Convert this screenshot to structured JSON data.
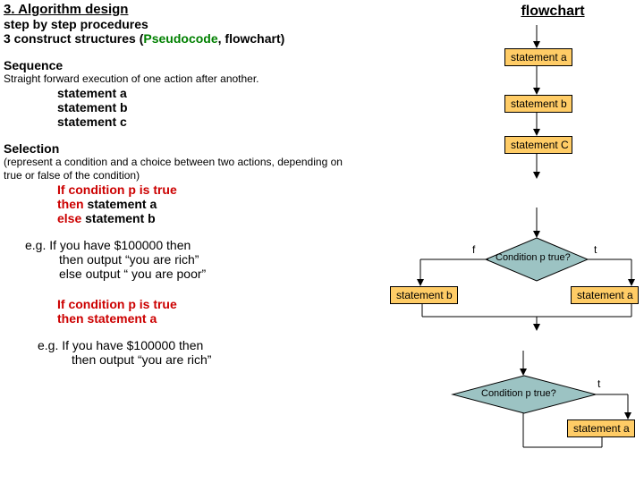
{
  "header": {
    "title": "3. Algorithm design",
    "sub1": "step by step procedures",
    "sub2a": "3 construct structures (",
    "sub2b": "Pseudocode",
    "sub2c": ", flowchart)"
  },
  "sequence": {
    "head": "Sequence",
    "desc": "Straight forward execution of one action after another.",
    "s1": "statement a",
    "s2": "statement b",
    "s3": "statement c"
  },
  "selection": {
    "head": "Selection",
    "desc": "(represent a condition and a choice between two actions, depending on true or false of the condition)",
    "l1a": "If condition p is true",
    "l2a": "then ",
    "l2b": "statement a",
    "l3a": "else ",
    "l3b": "statement b",
    "eg": "e.g.  If you have $100000 then",
    "eg2": "then output “you are rich”",
    "eg3": "else output “ you are poor”",
    "p2a": "If condition p is true",
    "p2b": "then statement a",
    "eg4": "e.g.  If you have $100000 then",
    "eg5": "then output “you are rich”"
  },
  "flow": {
    "title": "flowchart",
    "b1": "statement a",
    "b2": "statement b",
    "b3": "statement C",
    "d1": "Condition p true?",
    "sb": "statement b",
    "sa": "statement a",
    "d2": "Condition p true?",
    "sa2": "statement a",
    "f": "f",
    "t": "t",
    "t2": "t"
  }
}
